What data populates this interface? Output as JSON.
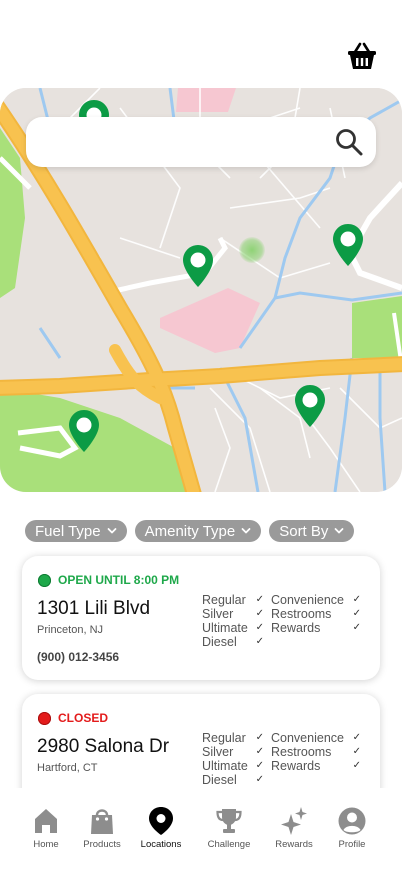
{
  "search": {
    "placeholder": ""
  },
  "filters": [
    {
      "label": "Fuel Type"
    },
    {
      "label": "Amenity Type"
    },
    {
      "label": "Sort By"
    }
  ],
  "stations": [
    {
      "status": "OPEN UNTIL 8:00 PM",
      "status_color": "#1ea84a",
      "address": "1301 Lili Blvd",
      "city": "Princeton, NJ",
      "phone": "(900) 012-3456",
      "fuels": [
        "Regular",
        "Silver",
        "Ultimate",
        "Diesel"
      ],
      "amenities": [
        "Convenience",
        "Restrooms",
        "Rewards"
      ]
    },
    {
      "status": "CLOSED",
      "status_color": "#e31b1b",
      "address": "2980 Salona Dr",
      "city": "Hartford, CT",
      "phone": "",
      "fuels": [
        "Regular",
        "Silver",
        "Ultimate",
        "Diesel"
      ],
      "amenities": [
        "Convenience",
        "Restrooms",
        "Rewards"
      ]
    }
  ],
  "check_glyph": "✓",
  "nav": [
    {
      "label": "Home",
      "icon": "home-icon"
    },
    {
      "label": "Products",
      "icon": "shopping-bag-icon"
    },
    {
      "label": "Locations",
      "icon": "location-pin-icon"
    },
    {
      "label": "Challenge",
      "icon": "trophy-icon"
    },
    {
      "label": "Rewards",
      "icon": "sparkle-icon"
    },
    {
      "label": "Profile",
      "icon": "profile-icon"
    }
  ],
  "colors": {
    "pin": "#0c9b45",
    "status_open": "#1ea84a",
    "status_closed": "#e31b1b",
    "chip": "#9a9a9a",
    "road_major": "#f8c24f",
    "water": "#9ec9f0",
    "park": "#a9e07a"
  }
}
